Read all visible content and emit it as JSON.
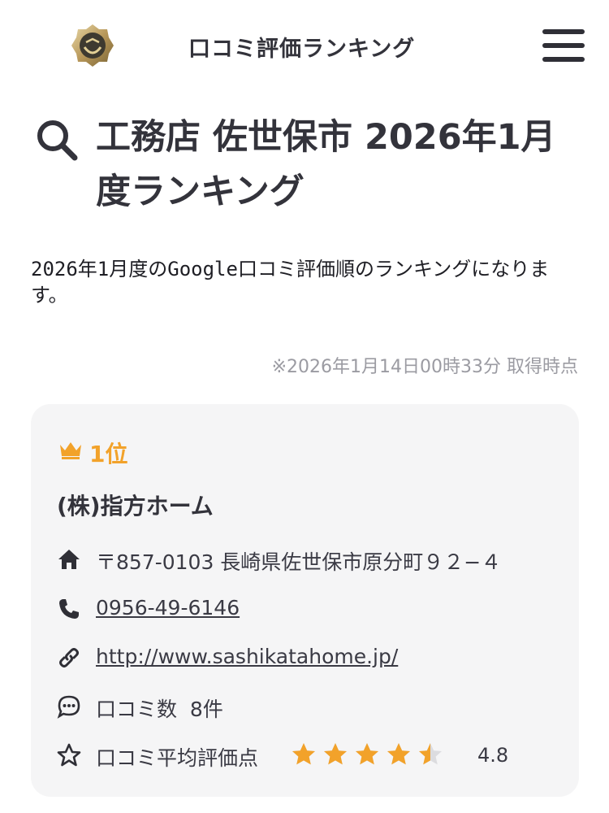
{
  "header": {
    "site_title": "口コミ評価ランキング",
    "logo_icon": "laurel-badge-icon",
    "menu_icon": "hamburger-menu-icon"
  },
  "page": {
    "heading": "工務店 佐世保市 2026年1月度ランキング",
    "heading_icon": "search-icon",
    "intro": "2026年1月度のGoogle口コミ評価順のランキングになります。",
    "timestamp": "※2026年1月14日00時33分 取得時点"
  },
  "ranking": [
    {
      "rank_label": "1位",
      "company": "(株)指方ホーム",
      "address": "〒857-0103 長崎県佐世保市原分町９２−４",
      "phone": "0956-49-6146",
      "url": "http://www.sashikatahome.jp/",
      "review_count_label": "口コミ数",
      "review_count": "8件",
      "rating_label": "口コミ平均評価点",
      "rating": 4.8,
      "rating_text": "4.8"
    }
  ],
  "colors": {
    "accent": "#f2a22a",
    "text": "#3a3a44",
    "card_bg": "#f5f5f6",
    "muted": "#9b9ba2"
  }
}
